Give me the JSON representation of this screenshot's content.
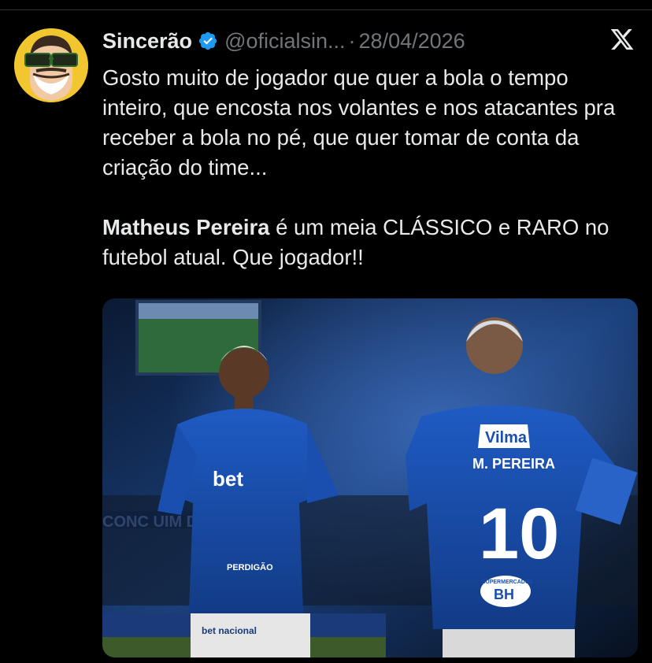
{
  "tweet": {
    "author_name": "Sincerão",
    "handle": "@oficialsin...",
    "separator": "·",
    "date": "28/04/2026",
    "text_para1": "Gosto muito de jogador que quer a bola o tempo inteiro, que encosta nos volantes e nos atacantes pra receber a bola no pé, que quer tomar de conta da criação do time...",
    "text_para2_bold": "Matheus Pereira",
    "text_para2_rest": " é um meia CLÁSSICO e RARO no futebol atual. Que jogador!!"
  },
  "media": {
    "jersey_sponsor": "Vilma",
    "jersey_name": "M. PEREIRA",
    "jersey_number": "10",
    "back_sponsor_top": "SUPERMERCADOS",
    "back_sponsor": "BH",
    "front_sponsor": "bet",
    "sleeve_text": "PERDIGÃO",
    "stadium_text": "CONC          UIM DE DE",
    "shorts_text": "bet nacional"
  },
  "icons": {
    "verified": "verified-badge-icon",
    "platform": "x-logo-icon",
    "accent": "#1d9bf0"
  }
}
